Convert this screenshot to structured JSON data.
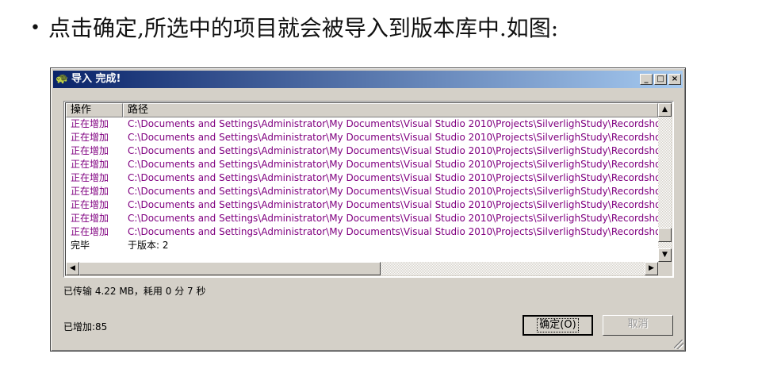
{
  "slide": {
    "bullet": "•",
    "text": "点击确定,所选中的项目就会被导入到版本库中.如图:"
  },
  "window": {
    "title": "导入 完成!",
    "buttons": {
      "minimize": "_",
      "maximize": "□",
      "close": "×"
    }
  },
  "list": {
    "columns": [
      "操作",
      "路径"
    ],
    "rows": [
      {
        "op": "正在增加",
        "path": "C:\\Documents and Settings\\Administrator\\My Documents\\Visual Studio 2010\\Projects\\SilverlighStudy\\Recordshop\\",
        "kind": "adding"
      },
      {
        "op": "正在增加",
        "path": "C:\\Documents and Settings\\Administrator\\My Documents\\Visual Studio 2010\\Projects\\SilverlighStudy\\Recordshop\\",
        "kind": "adding"
      },
      {
        "op": "正在增加",
        "path": "C:\\Documents and Settings\\Administrator\\My Documents\\Visual Studio 2010\\Projects\\SilverlighStudy\\Recordshop\\",
        "kind": "adding"
      },
      {
        "op": "正在增加",
        "path": "C:\\Documents and Settings\\Administrator\\My Documents\\Visual Studio 2010\\Projects\\SilverlighStudy\\Recordshop\\",
        "kind": "adding"
      },
      {
        "op": "正在增加",
        "path": "C:\\Documents and Settings\\Administrator\\My Documents\\Visual Studio 2010\\Projects\\SilverlighStudy\\Recordshop\\",
        "kind": "adding"
      },
      {
        "op": "正在增加",
        "path": "C:\\Documents and Settings\\Administrator\\My Documents\\Visual Studio 2010\\Projects\\SilverlighStudy\\Recordshop\\",
        "kind": "adding"
      },
      {
        "op": "正在增加",
        "path": "C:\\Documents and Settings\\Administrator\\My Documents\\Visual Studio 2010\\Projects\\SilverlighStudy\\Recordshop\\",
        "kind": "adding"
      },
      {
        "op": "正在增加",
        "path": "C:\\Documents and Settings\\Administrator\\My Documents\\Visual Studio 2010\\Projects\\SilverlighStudy\\Recordshop\\",
        "kind": "adding"
      },
      {
        "op": "正在增加",
        "path": "C:\\Documents and Settings\\Administrator\\My Documents\\Visual Studio 2010\\Projects\\SilverlighStudy\\Recordshop\\",
        "kind": "adding"
      },
      {
        "op": "完毕",
        "path": "于版本: 2",
        "kind": "done"
      }
    ]
  },
  "status": {
    "transferred": "已传输 4.22 MB，耗用 0 分 7 秒",
    "added": "已增加:85"
  },
  "buttons": {
    "ok": "确定(O)",
    "cancel": "取消"
  },
  "colors": {
    "adding_text": "#800080",
    "title_gradient_start": "#0a246a",
    "title_gradient_end": "#a6caf0"
  },
  "icons": [
    "turtle-icon",
    "minimize-icon",
    "maximize-icon",
    "close-icon",
    "scroll-up-icon",
    "scroll-down-icon",
    "scroll-left-icon",
    "scroll-right-icon",
    "resize-grip-icon"
  ]
}
